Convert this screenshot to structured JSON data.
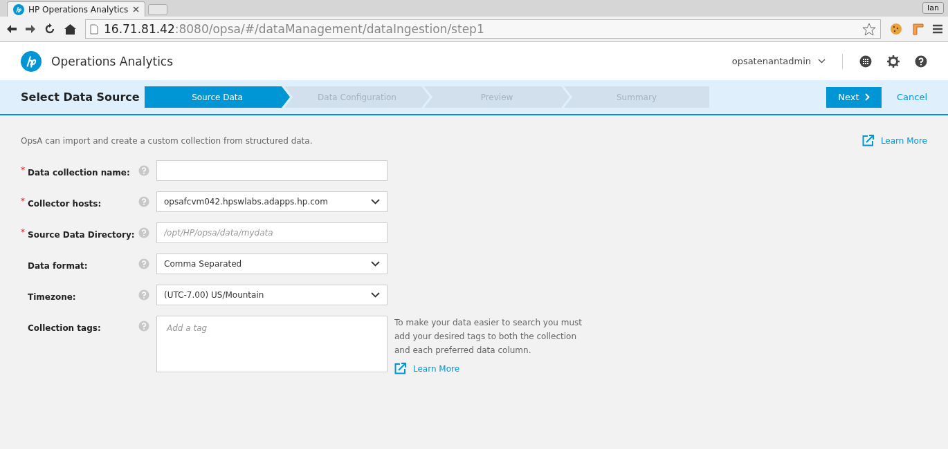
{
  "browser": {
    "tab_title": "HP Operations Analytics",
    "url_host": "16.71.81.42",
    "url_path": ":8080/opsa/#/dataManagement/dataIngestion/step1",
    "profile": "Ian"
  },
  "header": {
    "app_name": "Operations Analytics",
    "user": "opsatenantadmin"
  },
  "wizard": {
    "title": "Select Data Source",
    "steps": [
      {
        "label": "Source Data",
        "selected": true
      },
      {
        "label": "Data Configuration",
        "selected": false
      },
      {
        "label": "Preview",
        "selected": false
      },
      {
        "label": "Summary",
        "selected": false
      }
    ],
    "next_button": "Next",
    "cancel_link": "Cancel"
  },
  "intro": "OpsA can import and create a custom collection from structured data.",
  "learn_more_top": "Learn More",
  "fields": [
    {
      "kind": "text",
      "label": "Data collection name:",
      "required_mark": "*"
    },
    {
      "kind": "select",
      "label": "Collector hosts:",
      "required_mark": "*",
      "value": "opsafcvm042.hpswlabs.adapps.hp.com"
    },
    {
      "kind": "text",
      "label": "Source Data Directory:",
      "required_mark": "*",
      "placeholder": "/opt/HP/opsa/data/mydata"
    },
    {
      "kind": "select",
      "label": "Data format:",
      "value": "Comma Separated"
    },
    {
      "kind": "select",
      "label": "Timezone:",
      "value": "(UTC-7.00) US/Mountain"
    },
    {
      "kind": "tags",
      "label": "Collection tags:",
      "placeholder": "Add a tag",
      "hint": "To make your data easier to search you must add your desired tags to both the collection and each preferred data column.",
      "hint_link": "Learn More"
    }
  ]
}
